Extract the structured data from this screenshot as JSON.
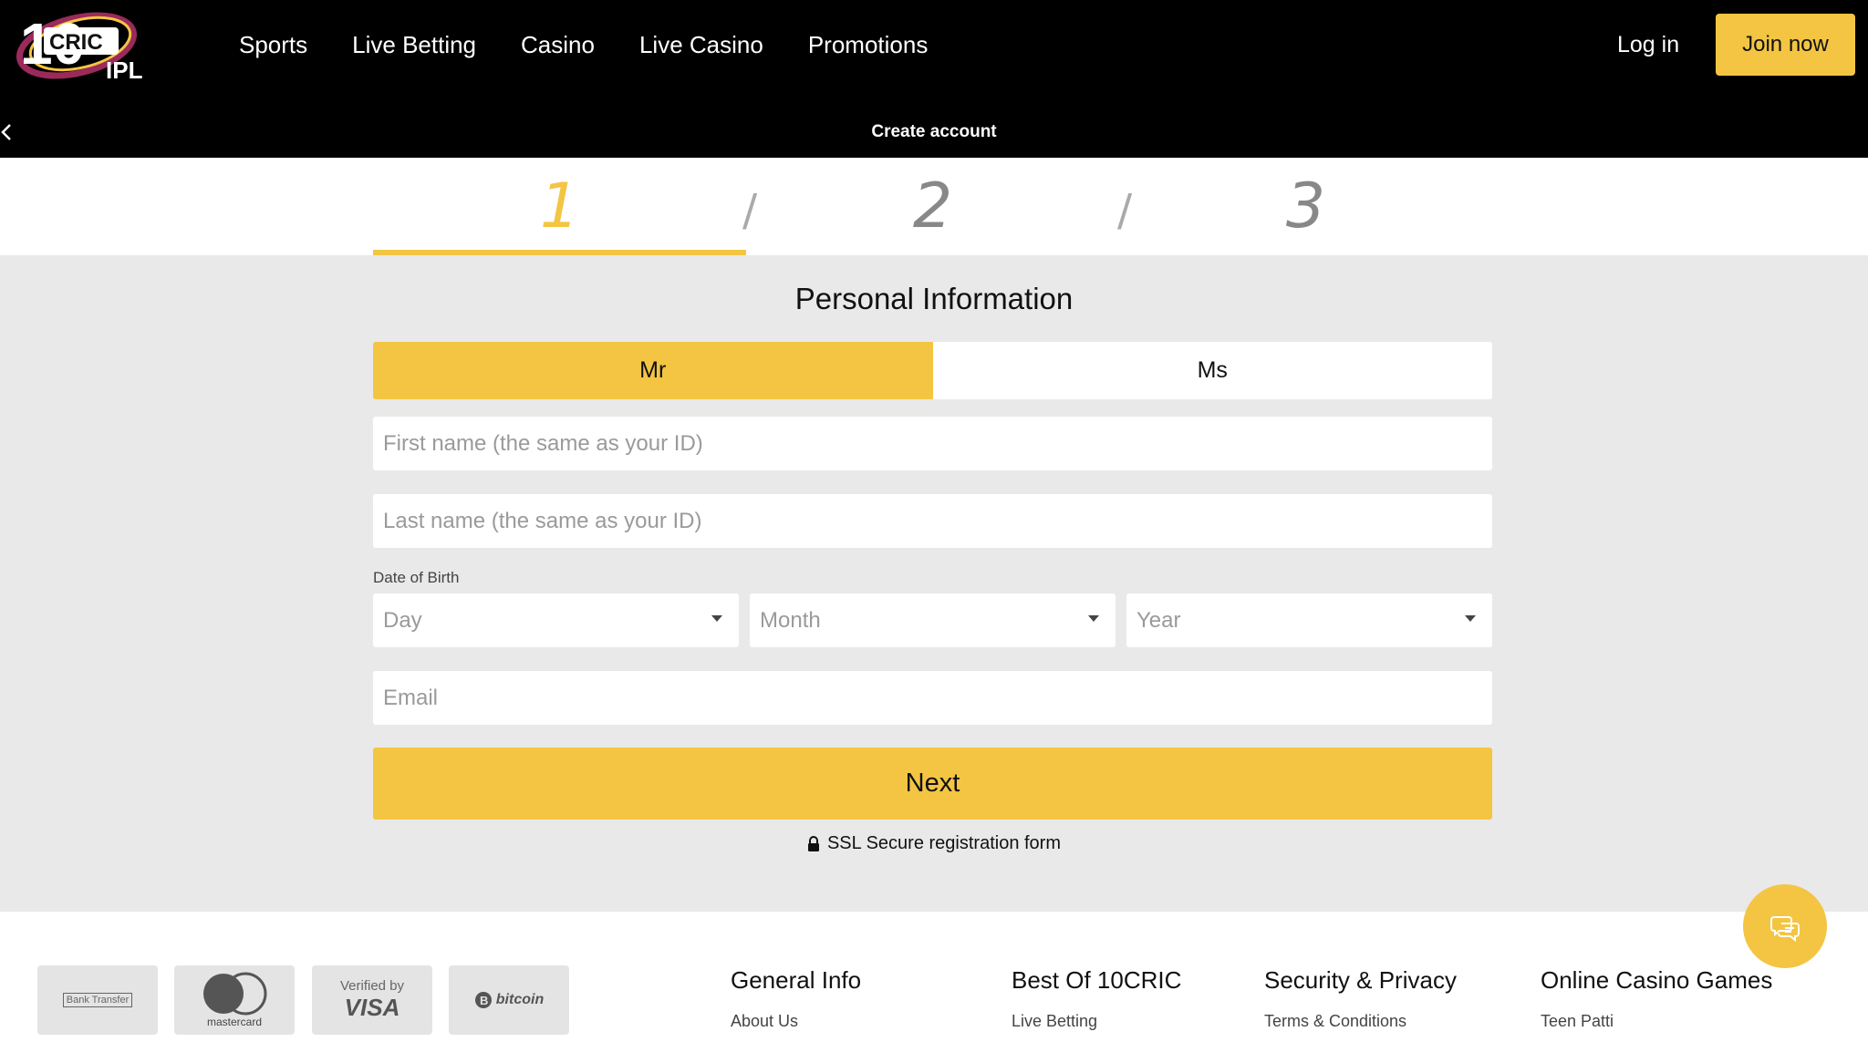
{
  "brand": {
    "logo_top": "CRIC",
    "logo_bottom": "IPL",
    "logo_number": "10"
  },
  "nav": [
    "Sports",
    "Live Betting",
    "Casino",
    "Live Casino",
    "Promotions"
  ],
  "header": {
    "login_label": "Log in",
    "join_label": "Join now",
    "subtitle": "Create account"
  },
  "steps": {
    "items": [
      "1",
      "2",
      "3"
    ],
    "active_index": 0
  },
  "form": {
    "title": "Personal Information",
    "gender_options": [
      "Mr",
      "Ms"
    ],
    "selected_gender": "Mr",
    "first_name_placeholder": "First name (the same as your ID)",
    "last_name_placeholder": "Last name (the same as your ID)",
    "dob_label": "Date of Birth",
    "day_placeholder": "Day",
    "month_placeholder": "Month",
    "year_placeholder": "Year",
    "email_placeholder": "Email",
    "next_label": "Next",
    "ssl_text": "SSL Secure registration form"
  },
  "payments": {
    "bank_transfer": "Bank Transfer",
    "mastercard": "mastercard",
    "visa_top": "Verified by",
    "visa_bottom": "VISA",
    "bitcoin": "bitcoin"
  },
  "footer_columns": [
    {
      "heading": "General Info",
      "first_link": "About Us"
    },
    {
      "heading": "Best Of 10CRIC",
      "first_link": "Live Betting"
    },
    {
      "heading": "Security & Privacy",
      "first_link": "Terms & Conditions"
    },
    {
      "heading": "Online Casino Games",
      "first_link": "Teen Patti"
    }
  ],
  "colors": {
    "accent": "#f3c543",
    "header_bg": "#000000",
    "page_bg": "#e9e9e9"
  },
  "icons": [
    "back-chevron-icon",
    "lock-icon",
    "chat-icon",
    "caret-down-icon"
  ]
}
